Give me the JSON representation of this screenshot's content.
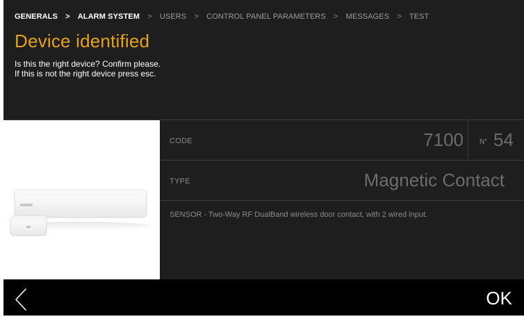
{
  "breadcrumb": {
    "items": [
      {
        "label": "GENERALS",
        "state": "active"
      },
      {
        "label": "ALARM SYSTEM",
        "state": "active"
      },
      {
        "label": "USERS",
        "state": "inactive"
      },
      {
        "label": "CONTROL PANEL PARAMETERS",
        "state": "inactive"
      },
      {
        "label": "MESSAGES",
        "state": "inactive"
      },
      {
        "label": "TEST",
        "state": "inactive"
      }
    ],
    "separator": ">"
  },
  "header": {
    "title": "Device identified",
    "message_line1": "Is this the right device? Confirm please.",
    "message_line2": "If this is not the right device press esc."
  },
  "device": {
    "code_label": "CODE",
    "code_value": "7100",
    "number_label": "N°",
    "number_value": "54",
    "type_label": "TYPE",
    "type_value": "Magnetic Contact",
    "description": "SENSOR - Two-Way RF DualBand wireless door contact, with 2 wired input."
  },
  "footer": {
    "back_icon": "chevron-left-icon",
    "ok_label": "OK"
  },
  "colors": {
    "accent": "#e6a21a",
    "background": "#1e1e1e",
    "footer_bg": "#000000"
  }
}
